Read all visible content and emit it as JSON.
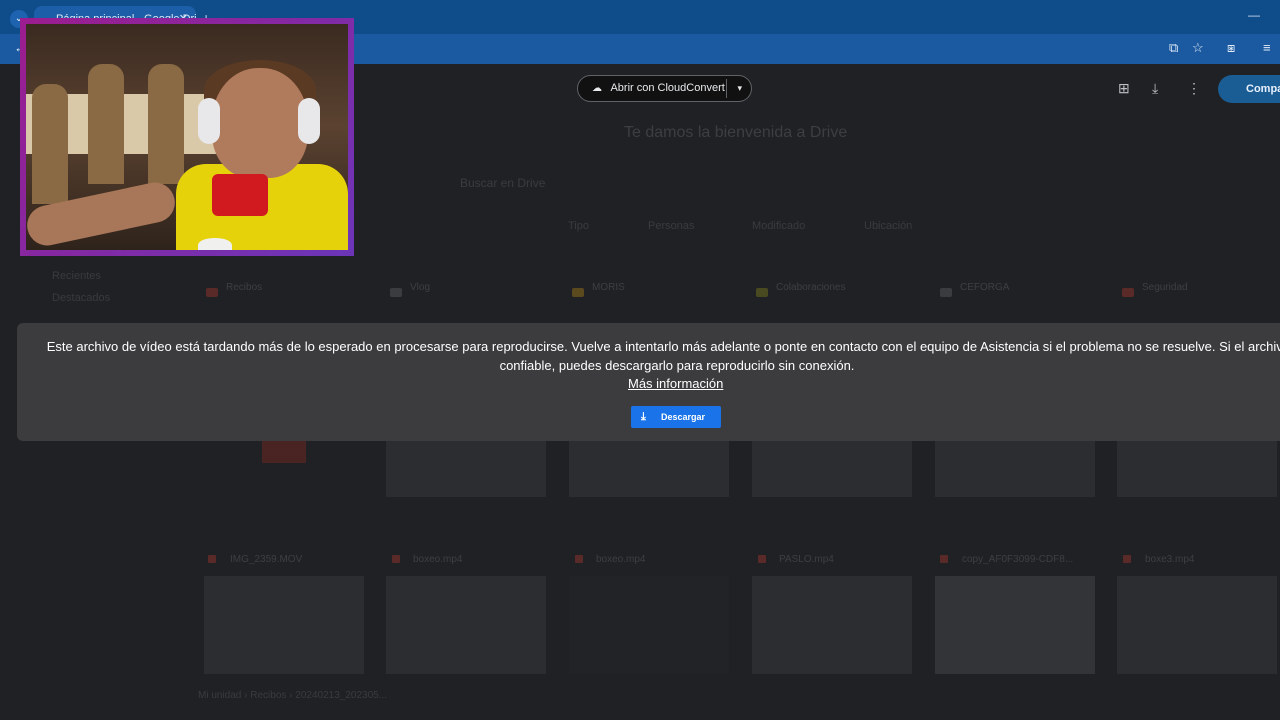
{
  "browser": {
    "tab_title": "Página principal - Google Drive",
    "tab_close": "✕",
    "new_tab": "+",
    "menu_glyph": "⌄",
    "minimize": "—"
  },
  "toolbar": {
    "back_glyph": "←",
    "icons": {
      "cast": "⧉",
      "bookmark": "☆",
      "extensions": "⧆",
      "reading_list": "≡"
    }
  },
  "drive": {
    "open_with_label": "Abrir con CloudConvert",
    "open_with_icon": "☁",
    "open_with_caret": "▾",
    "share_label": "Compa",
    "welcome": "Te damos la bienvenida a Drive",
    "search_placeholder": "Buscar en Drive",
    "filters": [
      "Tipo",
      "Personas",
      "Modificado",
      "Ubicación"
    ],
    "side_items": [
      "Recientes",
      "Destacados"
    ],
    "folders": [
      {
        "name": "Recibos",
        "color": "#5a2a28"
      },
      {
        "name": "Vlog",
        "color": "#3b3c3f"
      },
      {
        "name": "MORIS",
        "color": "#5a4a1e"
      },
      {
        "name": "Colaboraciones",
        "color": "#4a4a20"
      },
      {
        "name": "CEFORGA",
        "color": "#3b3c3f"
      },
      {
        "name": "Seguridad",
        "color": "#5a2a28"
      }
    ],
    "files_row2": [
      "IMG_2359.MOV",
      "boxeo.mp4",
      "boxeo.mp4",
      "PASLO.mp4",
      "copy_AF0F3099-CDF8...",
      "boxe3.mp4"
    ],
    "breadcrumb": [
      "Mi unidad",
      "Recibos",
      "20240213_202305..."
    ]
  },
  "banner": {
    "message": "Este archivo de vídeo está tardando más de lo esperado en procesarse para reproducirse. Vuelve a intentarlo más adelante o ponte en contacto con el equipo de Asistencia si el problema no se resuelve. Si el archivo es confiable, puedes descargarlo para reproducirlo sin conexión.",
    "link": "Más información",
    "download_label": "Descargar",
    "download_icon": "⤓"
  }
}
